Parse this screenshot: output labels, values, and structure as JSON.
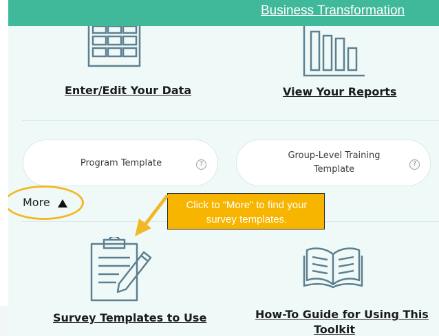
{
  "header": {
    "link_label": "Business Transformation"
  },
  "tiles": {
    "enter_edit_label": "Enter/Edit Your Data",
    "view_reports_label": "View Your Reports",
    "survey_templates_label": "Survey Templates to Use",
    "howto_line1": "How-To Guide for Using This",
    "howto_line2": "Toolkit"
  },
  "templates": {
    "program_label": "Program Template",
    "group_line1": "Group-Level Training",
    "group_line2": "Template",
    "help_glyph": "?"
  },
  "more": {
    "label": "More"
  },
  "callout": {
    "line1": "Click to “More” to find your",
    "line2": "survey templates."
  },
  "colors": {
    "header_bg": "#3fb99a",
    "canvas_bg": "#effaf8",
    "callout_bg": "#f7b500",
    "highlight_ring": "#f2b827",
    "icon_stroke": "#5e7f8f"
  }
}
